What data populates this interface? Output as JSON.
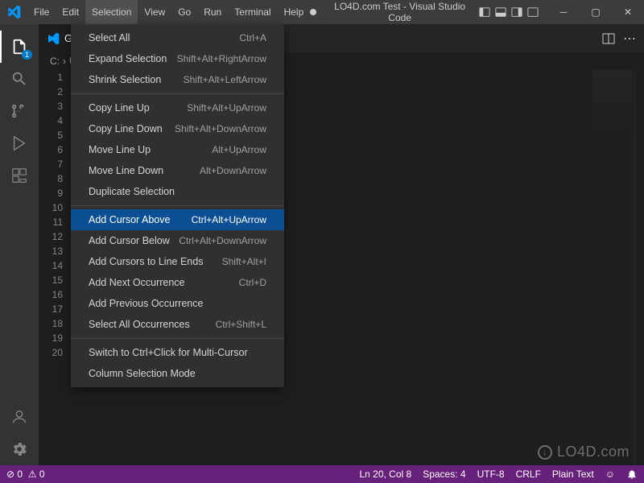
{
  "menubar": {
    "items": [
      "File",
      "Edit",
      "Selection",
      "View",
      "Go",
      "Run",
      "Terminal",
      "Help"
    ],
    "active_index": 2
  },
  "title": {
    "dirty": true,
    "text": "LO4D.com Test - Visual Studio Code"
  },
  "activitybar": {
    "explorer_badge": "1"
  },
  "tab": {
    "label": "Get S",
    "truncated": true
  },
  "breadcrumbs": {
    "segments": [
      "C:",
      "Use"
    ]
  },
  "editor": {
    "line_count": 20
  },
  "dropdown": {
    "groups": [
      [
        {
          "label": "Select All",
          "shortcut": "Ctrl+A"
        },
        {
          "label": "Expand Selection",
          "shortcut": "Shift+Alt+RightArrow"
        },
        {
          "label": "Shrink Selection",
          "shortcut": "Shift+Alt+LeftArrow"
        }
      ],
      [
        {
          "label": "Copy Line Up",
          "shortcut": "Shift+Alt+UpArrow"
        },
        {
          "label": "Copy Line Down",
          "shortcut": "Shift+Alt+DownArrow"
        },
        {
          "label": "Move Line Up",
          "shortcut": "Alt+UpArrow"
        },
        {
          "label": "Move Line Down",
          "shortcut": "Alt+DownArrow"
        },
        {
          "label": "Duplicate Selection",
          "shortcut": ""
        }
      ],
      [
        {
          "label": "Add Cursor Above",
          "shortcut": "Ctrl+Alt+UpArrow",
          "highlight": true
        },
        {
          "label": "Add Cursor Below",
          "shortcut": "Ctrl+Alt+DownArrow"
        },
        {
          "label": "Add Cursors to Line Ends",
          "shortcut": "Shift+Alt+I"
        },
        {
          "label": "Add Next Occurrence",
          "shortcut": "Ctrl+D"
        },
        {
          "label": "Add Previous Occurrence",
          "shortcut": ""
        },
        {
          "label": "Select All Occurrences",
          "shortcut": "Ctrl+Shift+L"
        }
      ],
      [
        {
          "label": "Switch to Ctrl+Click for Multi-Cursor",
          "shortcut": ""
        },
        {
          "label": "Column Selection Mode",
          "shortcut": ""
        }
      ]
    ]
  },
  "statusbar": {
    "errors": "0",
    "warnings": "0",
    "cursor": "Ln 20, Col 8",
    "spaces": "Spaces: 4",
    "encoding": "UTF-8",
    "eol": "CRLF",
    "language": "Plain Text",
    "feedback_icon": "☺"
  },
  "watermark": "LO4D.com"
}
